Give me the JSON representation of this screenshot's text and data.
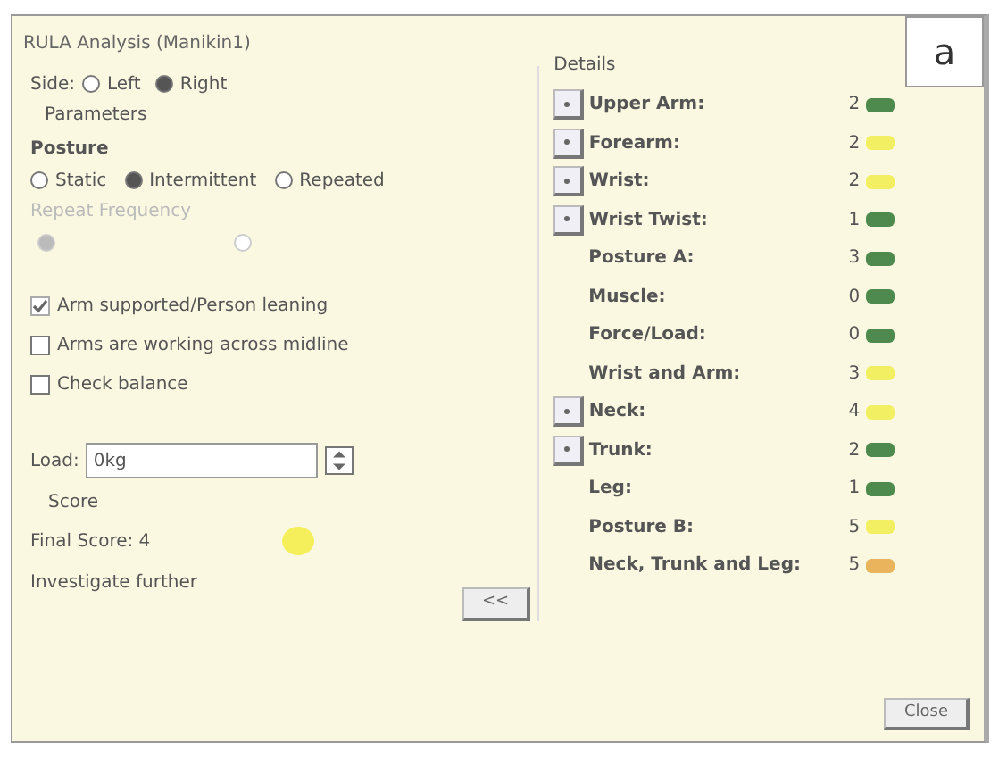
{
  "window": {
    "title": "RULA Analysis (Manikin1)"
  },
  "figure_label": "a",
  "side": {
    "label": "Side:",
    "options": [
      {
        "label": "Left",
        "selected": false
      },
      {
        "label": "Right",
        "selected": true
      }
    ]
  },
  "parameters": {
    "title": "Parameters",
    "posture_label": "Posture",
    "posture_options": [
      {
        "label": "Static",
        "selected": false
      },
      {
        "label": "Intermittent",
        "selected": true
      },
      {
        "label": "Repeated",
        "selected": false
      }
    ],
    "repeat_label": "Repeat Frequency",
    "repeat_options": [
      {
        "selected": true,
        "disabled": true
      },
      {
        "selected": false,
        "disabled": true
      }
    ],
    "checks": [
      {
        "label": "Arm supported/Person leaning",
        "checked": true,
        "disabled": true
      },
      {
        "label": "Arms are working across midline",
        "checked": false,
        "disabled": false
      },
      {
        "label": "Check balance",
        "checked": false,
        "disabled": false
      }
    ],
    "load": {
      "label": "Load:",
      "value": "0kg"
    }
  },
  "score": {
    "title": "Score",
    "final": "Final Score: 4",
    "color": "#f4ef5a",
    "advice": "Investigate further",
    "collapse_button": "<<"
  },
  "details": {
    "title": "Details",
    "rows": [
      {
        "kind": "expandable",
        "label": "Upper Arm:",
        "value": "2",
        "color": "#4e8a4e"
      },
      {
        "kind": "expandable",
        "label": "Forearm:",
        "value": "2",
        "color": "#f2ef62"
      },
      {
        "kind": "expandable",
        "label": "Wrist:",
        "value": "2",
        "color": "#f2ef62"
      },
      {
        "kind": "expandable",
        "label": "Wrist Twist:",
        "value": "1",
        "color": "#4e8a4e"
      },
      {
        "kind": "summary",
        "label": "Posture A:",
        "value": "3",
        "color": "#4e8a4e"
      },
      {
        "kind": "summary",
        "label": "Muscle:",
        "value": "0",
        "color": "#4e8a4e"
      },
      {
        "kind": "summary",
        "label": "Force/Load:",
        "value": "0",
        "color": "#4e8a4e"
      },
      {
        "kind": "summary",
        "label": "Wrist and Arm:",
        "value": "3",
        "color": "#f2ef62"
      },
      {
        "kind": "expandable",
        "label": "Neck:",
        "value": "4",
        "color": "#f2ef62"
      },
      {
        "kind": "expandable",
        "label": "Trunk:",
        "value": "2",
        "color": "#4e8a4e"
      },
      {
        "kind": "summary",
        "label": "Leg:",
        "value": "1",
        "color": "#4e8a4e"
      },
      {
        "kind": "summary",
        "label": "Posture B:",
        "value": "5",
        "color": "#f2ef62"
      },
      {
        "kind": "summary",
        "label": "Neck, Trunk and Leg:",
        "value": "5",
        "color": "#e9b45c"
      }
    ]
  },
  "buttons": [
    {
      "label": "Close"
    }
  ]
}
